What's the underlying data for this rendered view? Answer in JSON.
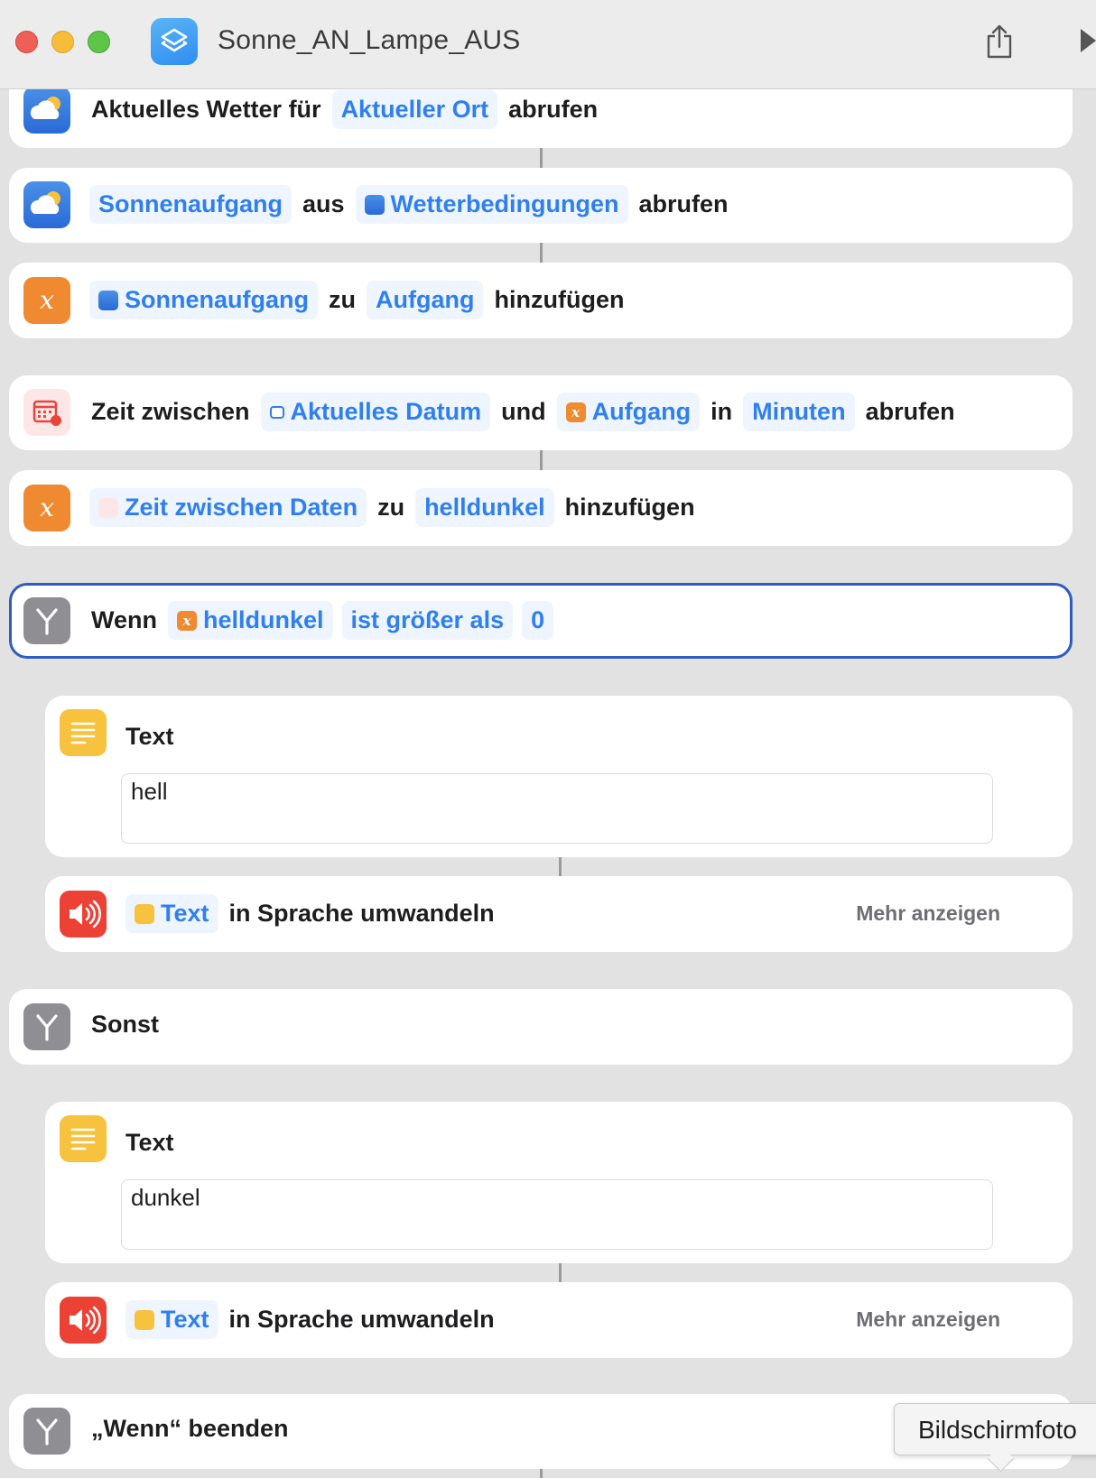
{
  "window": {
    "title": "Sonne_AN_Lampe_AUS",
    "app_icon": "shortcuts-icon",
    "toolbar_icons": [
      "share-icon",
      "play-icon"
    ]
  },
  "actions": [
    {
      "icon": "weather-icon",
      "parts": [
        {
          "type": "word",
          "text": "Aktuelles Wetter für"
        },
        {
          "type": "pill",
          "text": "Aktueller Ort"
        },
        {
          "type": "word",
          "text": "abrufen"
        }
      ]
    },
    {
      "icon": "weather-icon",
      "parts": [
        {
          "type": "pill",
          "text": "Sonnenaufgang"
        },
        {
          "type": "word",
          "text": "aus"
        },
        {
          "type": "pill",
          "text": "Wetterbedingungen",
          "icon": "weather-icon"
        },
        {
          "type": "word",
          "text": "abrufen"
        }
      ]
    },
    {
      "icon": "variable-icon",
      "parts": [
        {
          "type": "pill",
          "text": "Sonnenaufgang",
          "icon": "weather-icon"
        },
        {
          "type": "word",
          "text": "zu"
        },
        {
          "type": "pill",
          "text": "Aufgang"
        },
        {
          "type": "word",
          "text": "hinzufügen"
        }
      ]
    },
    {
      "icon": "calendar-icon",
      "parts": [
        {
          "type": "word",
          "text": "Zeit zwischen"
        },
        {
          "type": "pill",
          "text": "Aktuelles Datum",
          "icon": "calendar-icon"
        },
        {
          "type": "word",
          "text": "und"
        },
        {
          "type": "pill",
          "text": "Aufgang",
          "icon": "variable-icon"
        },
        {
          "type": "word",
          "text": "in"
        },
        {
          "type": "pill",
          "text": "Minuten"
        },
        {
          "type": "word",
          "text": "abrufen"
        }
      ]
    },
    {
      "icon": "variable-icon",
      "parts": [
        {
          "type": "pill",
          "text": "Zeit zwischen Daten",
          "icon": "calendar-icon"
        },
        {
          "type": "word",
          "text": "zu"
        },
        {
          "type": "pill",
          "text": "helldunkel"
        },
        {
          "type": "word",
          "text": "hinzufügen"
        }
      ]
    },
    {
      "icon": "if-icon",
      "selected": true,
      "parts": [
        {
          "type": "word",
          "text": "Wenn"
        },
        {
          "type": "pill",
          "text": "helldunkel",
          "icon": "variable-icon"
        },
        {
          "type": "pill",
          "text": "ist größer als"
        },
        {
          "type": "pill",
          "text": "0"
        }
      ]
    }
  ],
  "if_branch": {
    "text_block": {
      "title": "Text",
      "value": "hell"
    },
    "speak": {
      "pill": "Text",
      "label": "in Sprache umwandeln",
      "more": "Mehr anzeigen"
    }
  },
  "otherwise": {
    "label": "Sonst"
  },
  "else_branch": {
    "text_block": {
      "title": "Text",
      "value": "dunkel"
    },
    "speak": {
      "pill": "Text",
      "label": "in Sprache umwandeln",
      "more": "Mehr anzeigen"
    }
  },
  "end_if": {
    "label": "„Wenn“ beenden"
  },
  "tooltip": {
    "text": "Bildschirmfoto"
  },
  "colors": {
    "accent": "#2f7ff0",
    "pill_bg": "#eef5ff",
    "selection": "#2c5cc4",
    "variable": "#f08a30",
    "text_action": "#f7c23d",
    "speak_action": "#ec4135",
    "control_flow": "#8e8e93"
  }
}
